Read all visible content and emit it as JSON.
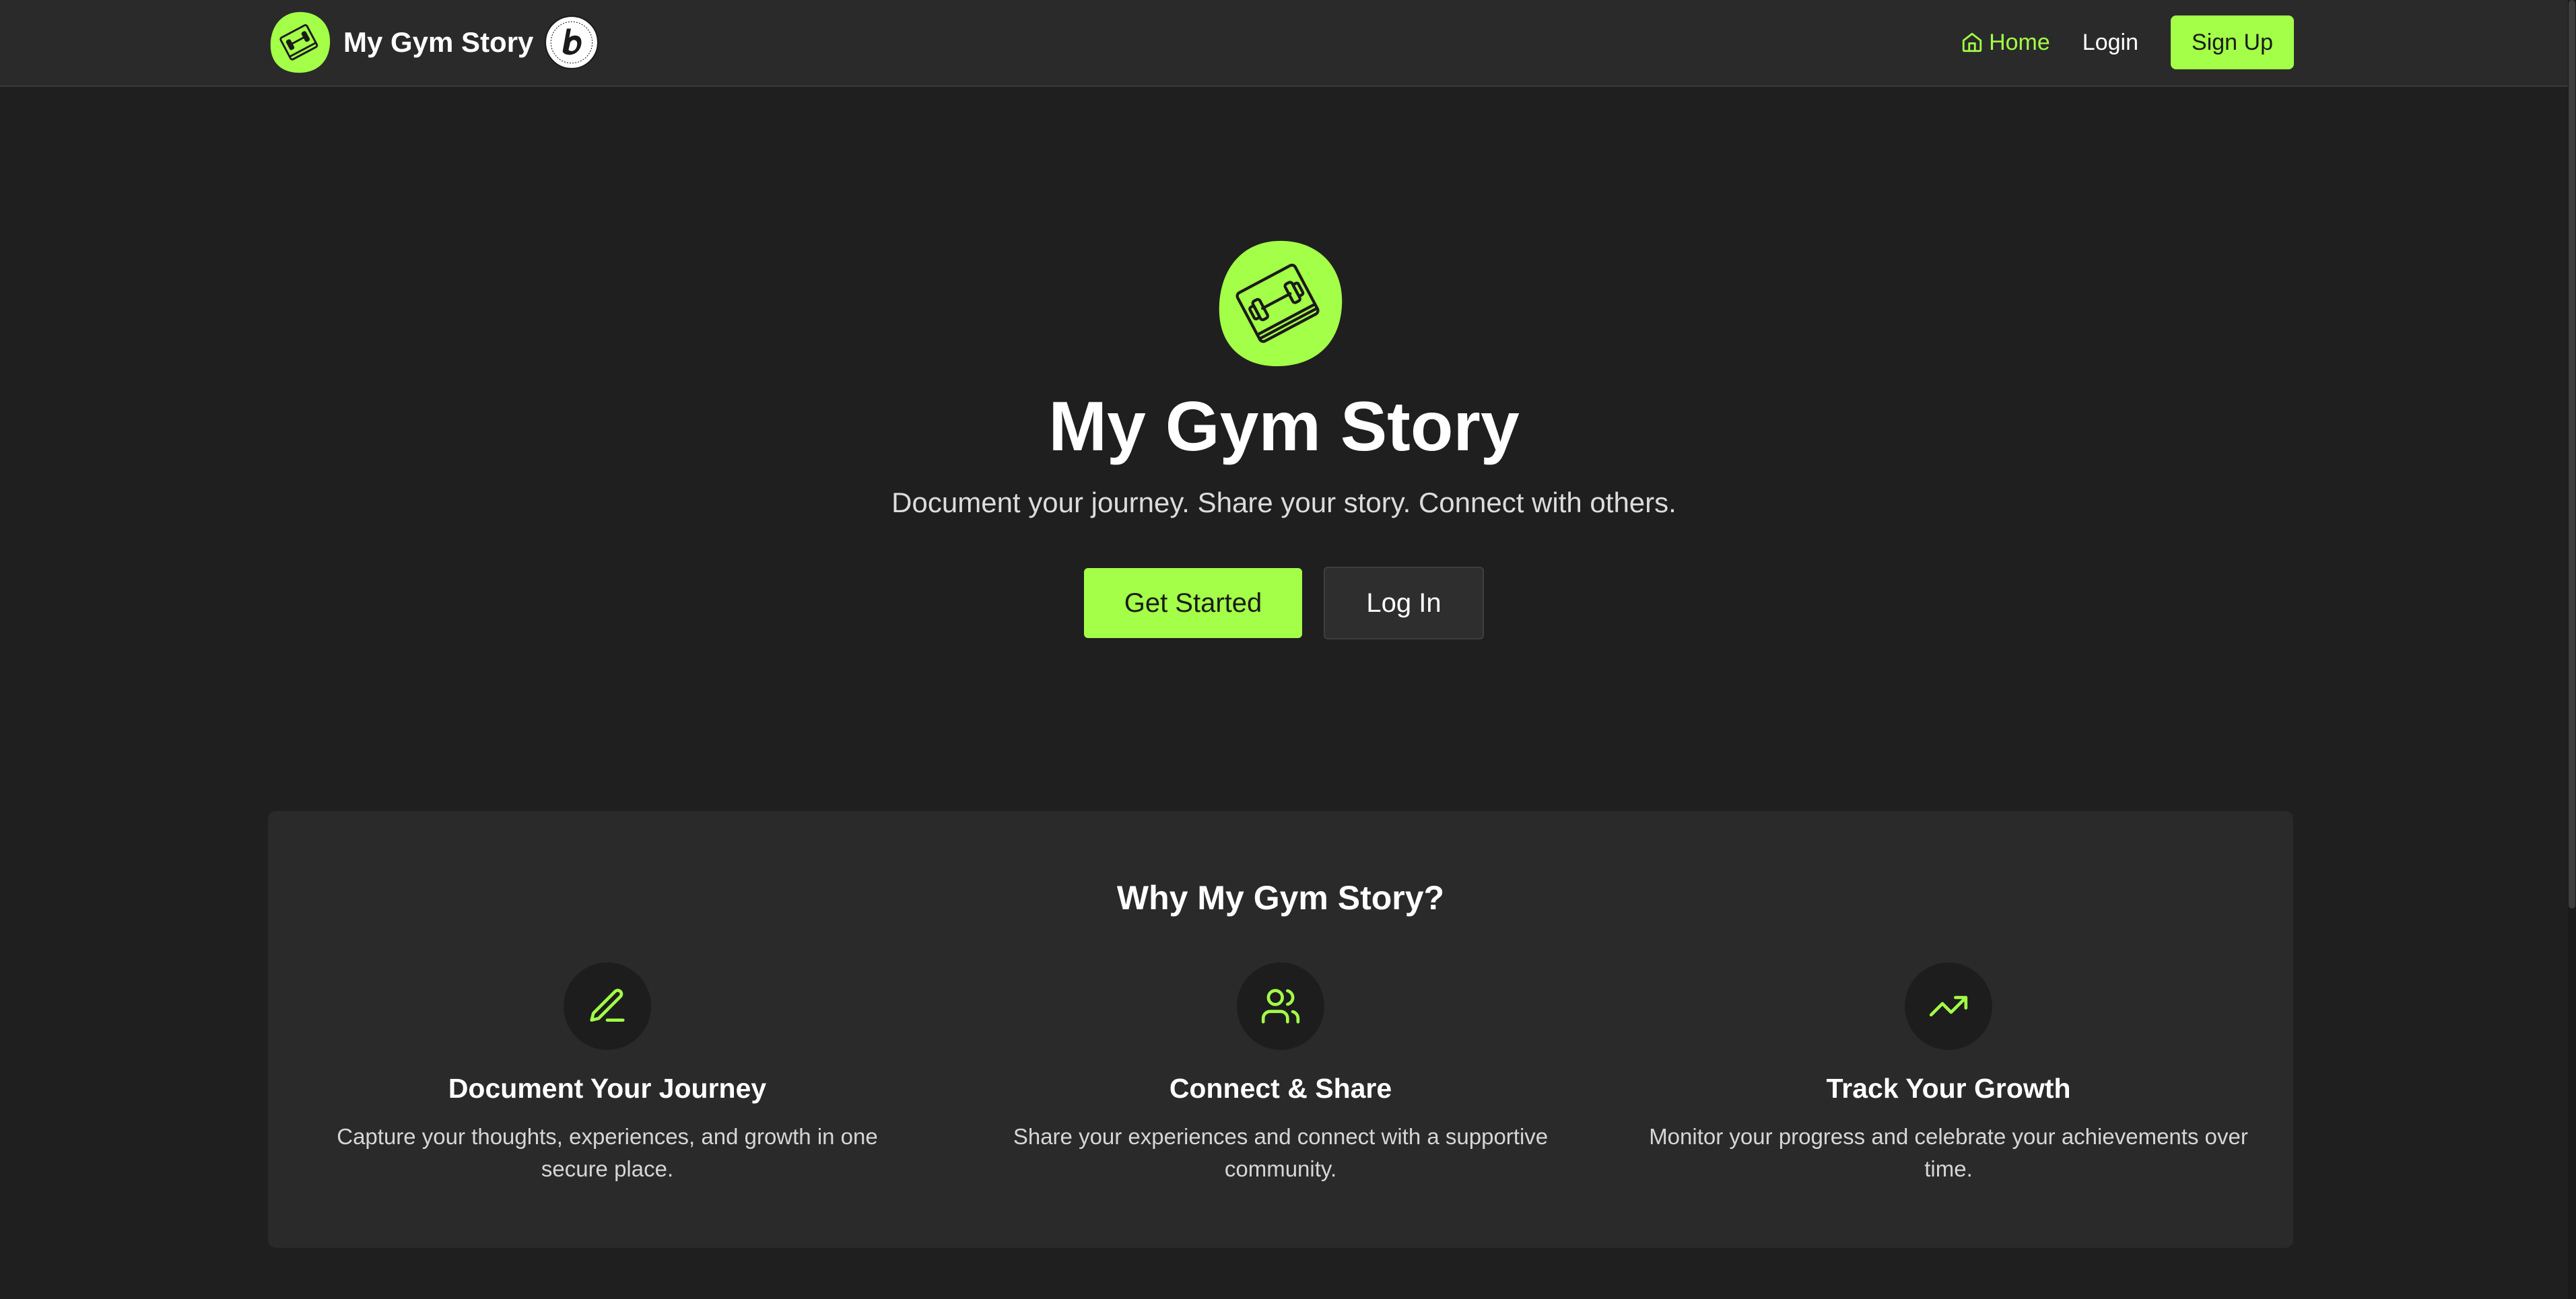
{
  "header": {
    "brand_name": "My Gym Story",
    "nav": {
      "home_label": "Home",
      "login_label": "Login",
      "signup_label": "Sign Up"
    }
  },
  "hero": {
    "title": "My Gym Story",
    "subtitle": "Document your journey. Share your story. Connect with others.",
    "primary_cta": "Get Started",
    "secondary_cta": "Log In"
  },
  "features": {
    "title": "Why My Gym Story?",
    "items": [
      {
        "icon": "pencil-icon",
        "title": "Document Your Journey",
        "description": "Capture your thoughts, experiences, and growth in one secure place."
      },
      {
        "icon": "users-icon",
        "title": "Connect & Share",
        "description": "Share your experiences and connect with a supportive community."
      },
      {
        "icon": "trending-up-icon",
        "title": "Track Your Growth",
        "description": "Monitor your progress and celebrate your achievements over time."
      }
    ]
  },
  "colors": {
    "accent": "#a3ff47",
    "background": "#1f1f1f",
    "header_bg": "#2a2a2a",
    "card_bg": "#2a2a2a"
  }
}
